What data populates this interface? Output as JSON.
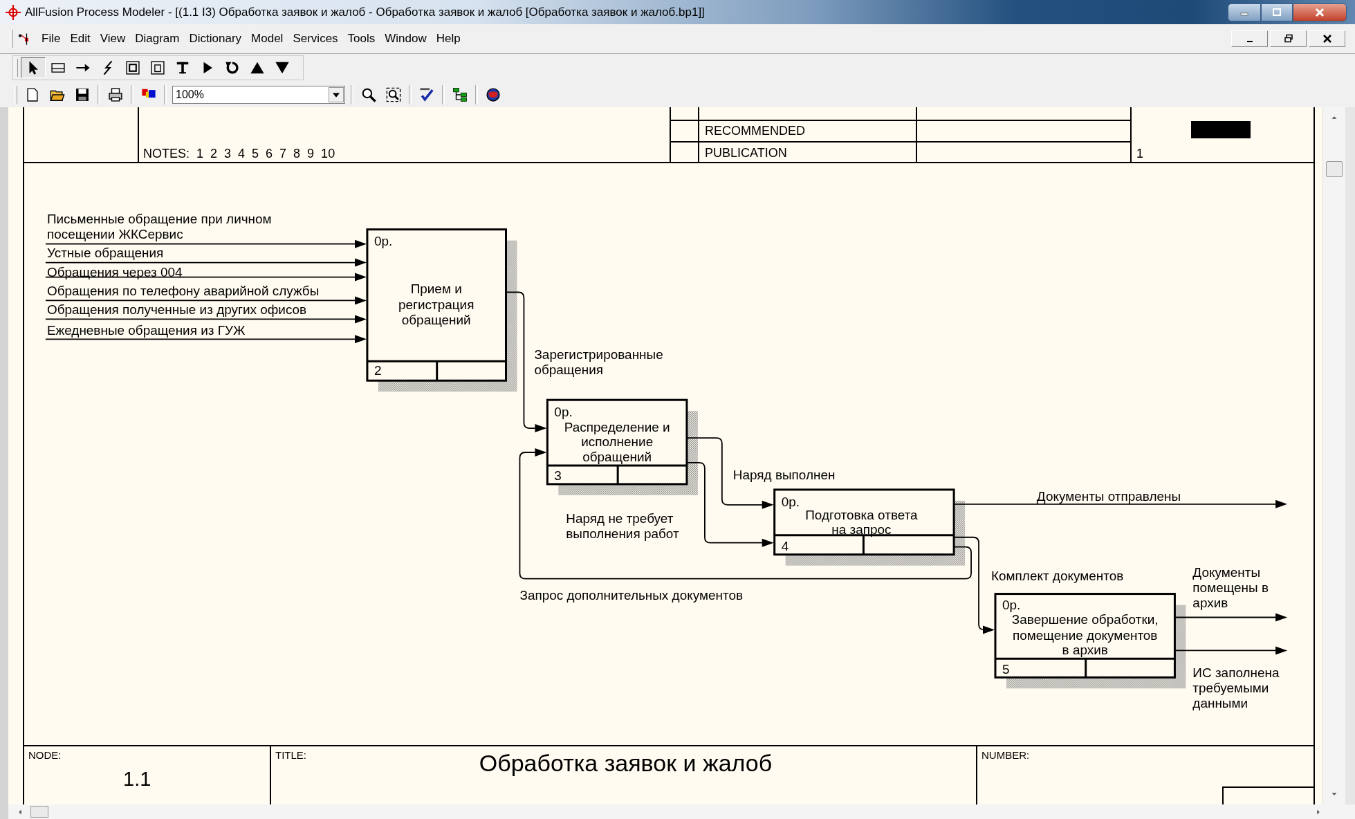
{
  "window": {
    "title": "AllFusion Process Modeler - [(1.1 I3) Обработка заявок и жалоб - Обработка заявок и жалоб  [Обработка заявок и жалоб.bp1]]"
  },
  "menu": [
    "File",
    "Edit",
    "View",
    "Diagram",
    "Dictionary",
    "Model",
    "Services",
    "Tools",
    "Window",
    "Help"
  ],
  "tools": [
    {
      "kind": "pointer",
      "selected": true
    },
    {
      "kind": "box",
      "selected": false
    },
    {
      "kind": "arrow",
      "selected": false
    },
    {
      "kind": "squiggle",
      "selected": false
    },
    {
      "kind": "offpage",
      "selected": false
    },
    {
      "kind": "referent",
      "selected": false
    },
    {
      "kind": "text",
      "selected": false
    },
    {
      "kind": "play",
      "selected": false
    },
    {
      "kind": "rotate",
      "selected": false
    },
    {
      "kind": "up",
      "selected": false
    },
    {
      "kind": "down",
      "selected": false
    }
  ],
  "toolbar": [
    {
      "kind": "new"
    },
    {
      "kind": "open"
    },
    {
      "kind": "save"
    },
    {
      "kind": "separator"
    },
    {
      "kind": "print"
    },
    {
      "kind": "separator"
    },
    {
      "kind": "color"
    },
    {
      "kind": "separator"
    },
    {
      "kind": "zoom",
      "value": "100%"
    },
    {
      "kind": "separator"
    },
    {
      "kind": "zoomin"
    },
    {
      "kind": "zoomfit"
    },
    {
      "kind": "separator"
    },
    {
      "kind": "spell"
    },
    {
      "kind": "separator"
    },
    {
      "kind": "tree"
    },
    {
      "kind": "separator"
    },
    {
      "kind": "globe"
    }
  ],
  "header": {
    "notes": "NOTES:  1  2  3  4  5  6  7  8  9  10",
    "statuses": [
      "RECOMMENDED",
      "PUBLICATION"
    ],
    "page": "1"
  },
  "diagram": {
    "boxes": [
      {
        "cost": "0р.",
        "lines": [
          "Прием и",
          "регистрация",
          "обращений"
        ],
        "number": "2"
      },
      {
        "cost": "0р.",
        "lines": [
          "Распределение и",
          "исполнение",
          "обращений"
        ],
        "number": "3"
      },
      {
        "cost": "0р.",
        "lines": [
          "Подготовка ответа",
          "на запрос"
        ],
        "number": "4"
      },
      {
        "cost": "0р.",
        "lines": [
          "Завершение обработки,",
          "помещение документов",
          "в архив"
        ],
        "number": "5"
      }
    ],
    "arrows": [
      {
        "lines": [
          "Письменные обращение при личном",
          "посещении ЖКСервис"
        ]
      },
      {
        "lines": [
          "Устные обращения"
        ]
      },
      {
        "lines": [
          "Обращения через 004"
        ]
      },
      {
        "lines": [
          "Обращения по телефону аварийной службы"
        ]
      },
      {
        "lines": [
          "Обращения полученные из других офисов"
        ]
      },
      {
        "lines": [
          "Ежедневные обращения из ГУЖ"
        ]
      },
      {
        "lines": [
          "Зарегистрированные",
          "обращения"
        ]
      },
      {
        "lines": [
          "Наряд выполнен"
        ]
      },
      {
        "lines": [
          "Наряд не требует",
          "выполнения работ"
        ]
      },
      {
        "lines": [
          "Документы отправлены"
        ]
      },
      {
        "lines": [
          "Комплект документов"
        ]
      },
      {
        "lines": [
          "Запрос дополнительных документов"
        ]
      },
      {
        "lines": [
          "Документы",
          "помещены в",
          "архив"
        ]
      },
      {
        "lines": [
          "ИС заполнена",
          "требуемыми",
          "данными"
        ]
      }
    ]
  },
  "footer": {
    "node_label": "NODE:",
    "node": "1.1",
    "title_label": "TITLE:",
    "title": "Обработка заявок и жалоб",
    "number_label": "NUMBER:"
  }
}
